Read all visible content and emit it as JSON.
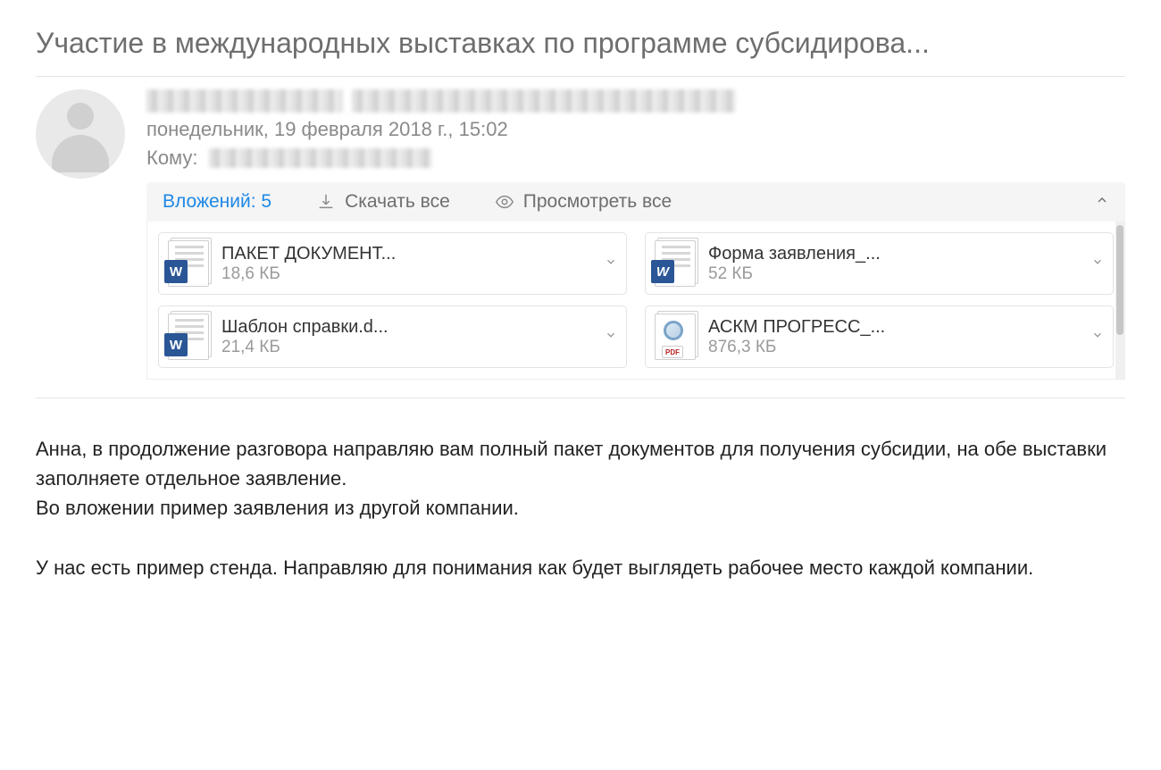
{
  "subject": "Участие в международных выставках по программе субсидирова...",
  "date": "понедельник, 19 февраля 2018 г., 15:02",
  "to_label": "Кому:",
  "attachments_bar": {
    "count_label": "Вложений: 5",
    "download_all": "Скачать все",
    "preview_all": "Просмотреть все"
  },
  "attachments": [
    {
      "name": "ПАКЕТ ДОКУМЕНТ...",
      "size": "18,6 КБ",
      "icon": "word"
    },
    {
      "name": "Форма заявления_...",
      "size": "52 КБ",
      "icon": "word-old"
    },
    {
      "name": "Шаблон справки.d...",
      "size": "21,4 КБ",
      "icon": "word"
    },
    {
      "name": "АСКМ ПРОГРЕСС_...",
      "size": "876,3 КБ",
      "icon": "pdf"
    }
  ],
  "body": {
    "p1": "Анна, в продолжение разговора направляю вам полный пакет документов для получения субсидии, на обе выставки заполняете отдельное заявление.",
    "p2": "Во вложении пример заявления из другой компании.",
    "p3": "У нас есть пример стенда. Направляю для понимания как будет выглядеть рабочее место каждой компании."
  }
}
